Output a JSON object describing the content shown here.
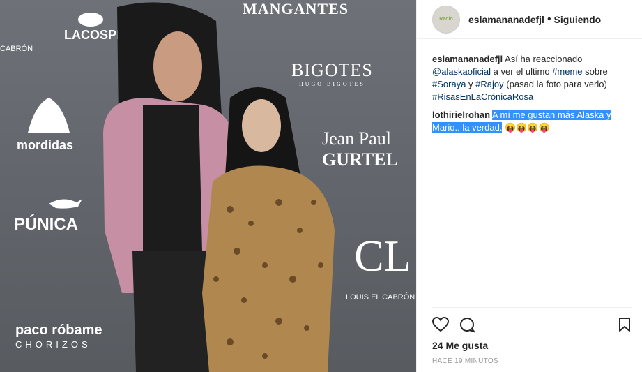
{
  "photo": {
    "logos": {
      "mangantes": "MANGANTES",
      "lacospe": "LACOSPE",
      "bigotes": "BIGOTES",
      "bigotes_sub": "HUGO   BIGOTES",
      "mordidas": "mordidas",
      "jeanpaul": "Jean Paul",
      "gurtel": "GURTEL",
      "punica": "PÚNICA",
      "louis": "LOUIS EL CABRÓN",
      "paco": "paco róbame",
      "chorizos": "CHORIZOS",
      "cabron": "CABRÓN"
    }
  },
  "header": {
    "username": "eslamananadefjl",
    "separator": "•",
    "follow_label": "Siguiendo"
  },
  "caption": {
    "user": "eslamananadefjl",
    "t1": "Así ha reaccionado",
    "mention": "@alaskaoficial",
    "t2": "a ver el ultimo",
    "tag_meme": "#meme",
    "t3": "sobre",
    "tag_soraya": "#Soraya",
    "t4": "y",
    "tag_rajoy": "#Rajoy",
    "t5": "(pasad la foto para verlo)",
    "tag_risas": "#RisasEnLaCrónicaRosa"
  },
  "comment": {
    "user": "lothirielrohan",
    "text": "A mí me gustan más Alaska y Mario.. la verdad.",
    "emojis": "😝😝😝😝"
  },
  "likes": "24 Me gusta",
  "timestamp": "HACE 19 MINUTOS"
}
